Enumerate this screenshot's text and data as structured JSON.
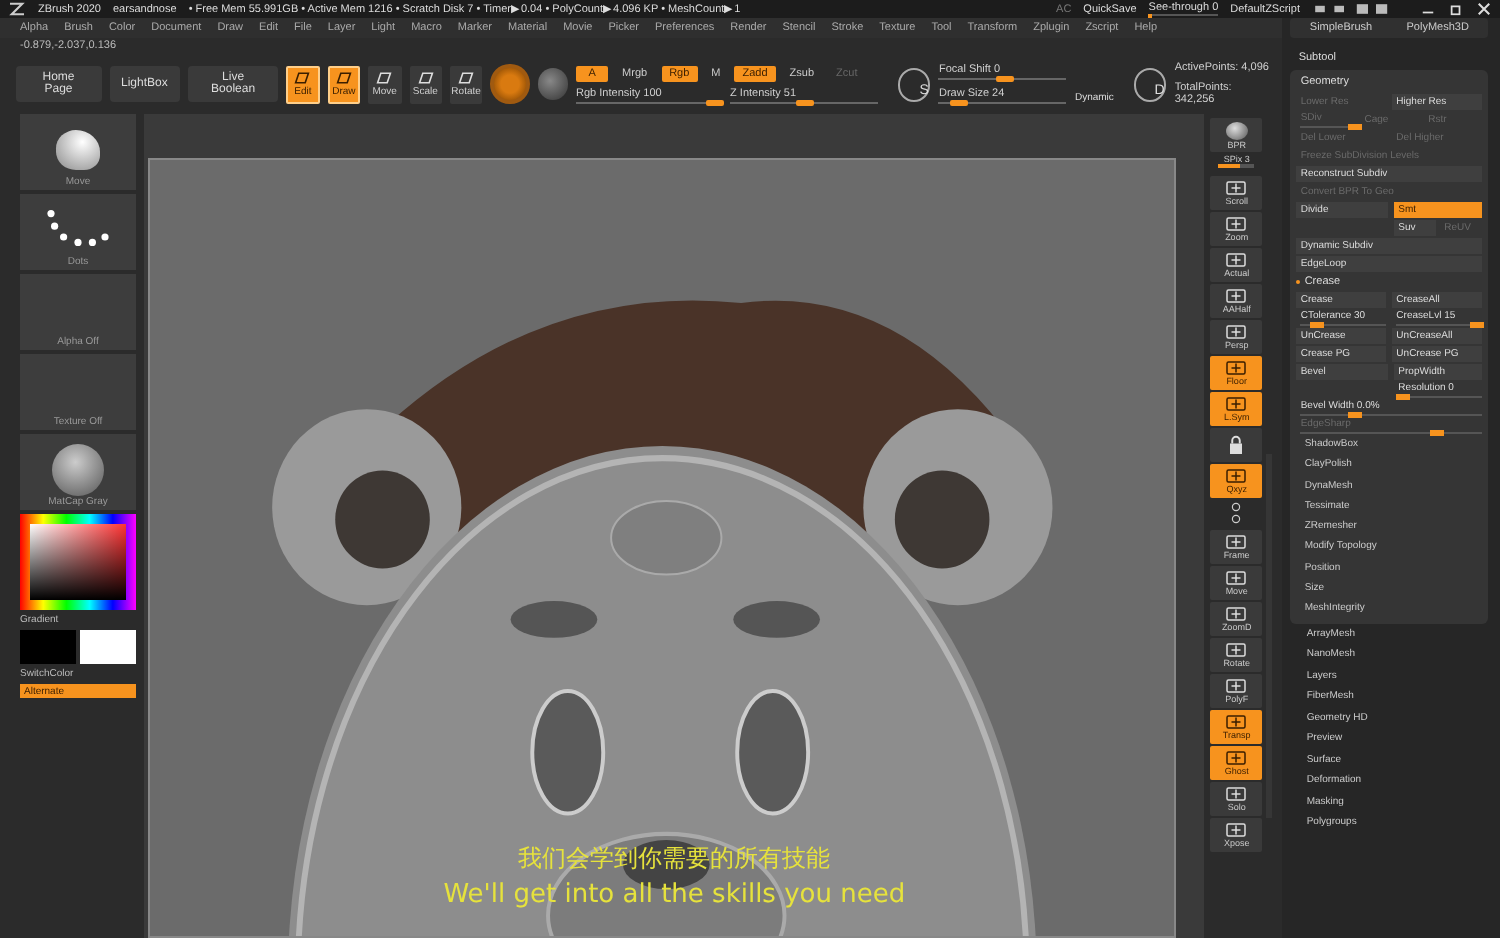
{
  "title_bar": {
    "app": "ZBrush 2020",
    "project": "earsandnose",
    "stats": "• Free Mem 55.991GB • Active Mem 1216 • Scratch Disk 7 • Timer▶0.04 • PolyCount▶4.096 KP • MeshCount▶1",
    "ac": "AC",
    "quicksave": "QuickSave",
    "see_through": {
      "label": "See-through  0",
      "level": 0
    },
    "script": "DefaultZScript"
  },
  "menu": [
    "Alpha",
    "Brush",
    "Color",
    "Document",
    "Draw",
    "Edit",
    "File",
    "Layer",
    "Light",
    "Macro",
    "Marker",
    "Material",
    "Movie",
    "Picker",
    "Preferences",
    "Render",
    "Stencil",
    "Stroke",
    "Texture",
    "Tool",
    "Transform",
    "Zplugin",
    "Zscript",
    "Help"
  ],
  "coordinates": "-0.879,-2.037,0.136",
  "toolbar": {
    "nav": [
      "Home Page",
      "LightBox",
      "Live Boolean"
    ],
    "modes": [
      {
        "label": "Edit",
        "on": true
      },
      {
        "label": "Draw",
        "on": true
      },
      {
        "label": "Move",
        "on": false
      },
      {
        "label": "Scale",
        "on": false
      },
      {
        "label": "Rotate",
        "on": false
      }
    ],
    "channels": [
      {
        "label": "A",
        "on": true,
        "disabled": false
      },
      {
        "label": "Mrgb",
        "on": false,
        "disabled": false
      },
      {
        "label": "Rgb",
        "on": true,
        "disabled": false
      },
      {
        "label": "M",
        "on": false,
        "disabled": false
      },
      {
        "label": "Zadd",
        "on": true,
        "disabled": false
      },
      {
        "label": "Zsub",
        "on": false,
        "disabled": false
      },
      {
        "label": "Zcut",
        "on": false,
        "disabled": true
      }
    ],
    "intensity": [
      {
        "label": "Rgb Intensity 100",
        "level": 1
      },
      {
        "label": "Z Intensity 51",
        "level": 0.51
      }
    ],
    "brush_key": "S",
    "brush_sliders": [
      {
        "label": "Focal Shift 0",
        "level": 0.5
      },
      {
        "label": "Draw Size 24",
        "level": 0.1
      }
    ],
    "dynamic": "Dynamic",
    "points_key": "D",
    "points": [
      "ActivePoints: 4,096",
      "TotalPoints: 342,256"
    ]
  },
  "left_shelf": {
    "brush": "Move",
    "stroke": "Dots",
    "alpha": "Alpha Off",
    "texture": "Texture Off",
    "material": "MatCap Gray",
    "gradient": "Gradient",
    "switch_color": "SwitchColor",
    "alternate": "Alternate"
  },
  "subtitles": [
    "我们会学到你需要的所有技能",
    "We'll get into all the skills you need"
  ],
  "right_shelf": [
    {
      "kind": "sphere",
      "label": "BPR"
    },
    {
      "kind": "slider",
      "label": "SPix 3",
      "level": 0.6
    },
    {
      "kind": "button",
      "label": "Scroll",
      "on": false
    },
    {
      "kind": "button",
      "label": "Zoom",
      "on": false
    },
    {
      "kind": "button",
      "label": "Actual",
      "on": false
    },
    {
      "kind": "button",
      "label": "AAHalf",
      "on": false
    },
    {
      "kind": "button",
      "label": "Persp",
      "on": false
    },
    {
      "kind": "button",
      "label": "Floor",
      "on": true
    },
    {
      "kind": "button",
      "label": "L.Sym",
      "on": true
    },
    {
      "kind": "lock"
    },
    {
      "kind": "button",
      "label": "Qxyz",
      "on": true
    },
    {
      "kind": "mini"
    },
    {
      "kind": "button",
      "label": "Frame",
      "on": false
    },
    {
      "kind": "button",
      "label": "Move",
      "on": false
    },
    {
      "kind": "button",
      "label": "ZoomD",
      "on": false
    },
    {
      "kind": "button",
      "label": "Rotate",
      "on": false
    },
    {
      "kind": "button",
      "label": "PolyF",
      "on": false
    },
    {
      "kind": "button",
      "label": "Transp",
      "on": true
    },
    {
      "kind": "button",
      "label": "Ghost",
      "on": true
    },
    {
      "kind": "button",
      "label": "Solo",
      "on": false
    },
    {
      "kind": "button",
      "label": "Xpose",
      "on": false
    }
  ],
  "right_panel": {
    "tools": [
      "SimpleBrush",
      "PolyMesh3D"
    ],
    "subtool": "Subtool",
    "geometry": "Geometry",
    "rows": [
      {
        "cells": [
          {
            "kind": "button",
            "label": "Lower Res",
            "disabled": true,
            "on": false
          },
          {
            "kind": "button",
            "label": "Higher Res",
            "disabled": false,
            "on": false
          }
        ]
      },
      {
        "cells": [
          {
            "kind": "slider",
            "label": "SDiv",
            "level": 1,
            "disabled": true
          },
          {
            "kind": "button",
            "label": "Cage",
            "disabled": true,
            "on": false
          },
          {
            "kind": "button",
            "label": "Rstr",
            "disabled": true,
            "on": false
          }
        ]
      },
      {
        "cells": [
          {
            "kind": "button",
            "label": "Del Lower",
            "disabled": true,
            "on": false
          },
          {
            "kind": "button",
            "label": "Del Higher",
            "disabled": true,
            "on": false
          }
        ]
      },
      {
        "cells": [
          {
            "kind": "button",
            "label": "Freeze SubDivision Levels",
            "disabled": true,
            "on": false
          }
        ]
      },
      {
        "cells": [
          {
            "kind": "button",
            "label": "Reconstruct Subdiv",
            "disabled": false,
            "on": false
          }
        ]
      },
      {
        "cells": [
          {
            "kind": "button",
            "label": "Convert BPR To Geo",
            "disabled": true,
            "on": false
          }
        ]
      },
      {
        "cells": [
          {
            "kind": "button",
            "label": "Divide",
            "disabled": false,
            "on": false
          },
          {
            "kind": "stack",
            "lines": [
              [
                {
                  "kind": "button",
                  "label": "Smt",
                  "disabled": false,
                  "on": true
                }
              ],
              [
                {
                  "kind": "button",
                  "label": "Suv",
                  "disabled": false,
                  "on": false
                },
                {
                  "kind": "button",
                  "label": "ReUV",
                  "disabled": true,
                  "on": false
                }
              ]
            ]
          }
        ]
      },
      {
        "cells": [
          {
            "kind": "button",
            "label": "Dynamic Subdiv",
            "disabled": false,
            "on": false
          }
        ]
      },
      {
        "cells": [
          {
            "kind": "button",
            "label": "EdgeLoop",
            "disabled": false,
            "on": false
          }
        ]
      },
      {
        "cells": [
          {
            "kind": "section",
            "label": "Crease",
            "expanded": true
          }
        ]
      },
      {
        "cells": [
          {
            "kind": "button",
            "label": "Crease",
            "disabled": false,
            "on": false
          },
          {
            "kind": "button",
            "label": "CreaseAll",
            "disabled": false,
            "on": false
          }
        ]
      },
      {
        "cells": [
          {
            "kind": "slider",
            "label": "CTolerance 30",
            "level": 0.2,
            "disabled": false
          },
          {
            "kind": "slider",
            "label": "CreaseLvl 15",
            "level": 0.95,
            "disabled": false
          }
        ]
      },
      {
        "cells": [
          {
            "kind": "button",
            "label": "UnCrease",
            "disabled": false,
            "on": false
          },
          {
            "kind": "button",
            "label": "UnCreaseAll",
            "disabled": false,
            "on": false
          }
        ]
      },
      {
        "cells": [
          {
            "kind": "button",
            "label": "Crease PG",
            "disabled": false,
            "on": false
          },
          {
            "kind": "button",
            "label": "UnCrease PG",
            "disabled": false,
            "on": false
          }
        ]
      },
      {
        "cells": [
          {
            "kind": "button",
            "label": "Bevel",
            "disabled": false,
            "on": false
          },
          {
            "kind": "stack",
            "lines": [
              [
                {
                  "kind": "button",
                  "label": "PropWidth",
                  "disabled": false,
                  "on": false
                }
              ],
              [
                {
                  "kind": "slider",
                  "label": "Resolution 0",
                  "level": 0.05,
                  "disabled": false
                }
              ]
            ]
          }
        ]
      },
      {
        "cells": [
          {
            "kind": "slider",
            "label": "Bevel Width 0.0%",
            "level": 0.3,
            "disabled": false
          }
        ]
      },
      {
        "cells": [
          {
            "kind": "slider",
            "label": "EdgeSharp",
            "level": 0.75,
            "disabled": true
          }
        ]
      }
    ],
    "subsections": [
      "ShadowBox",
      "ClayPolish",
      "DynaMesh",
      "Tessimate",
      "ZRemesher",
      "Modify Topology",
      "Position",
      "Size",
      "MeshIntegrity"
    ],
    "sections": [
      "ArrayMesh",
      "NanoMesh",
      "Layers",
      "FiberMesh",
      "Geometry HD",
      "Preview",
      "Surface",
      "Deformation",
      "Masking",
      "Polygroups"
    ]
  }
}
